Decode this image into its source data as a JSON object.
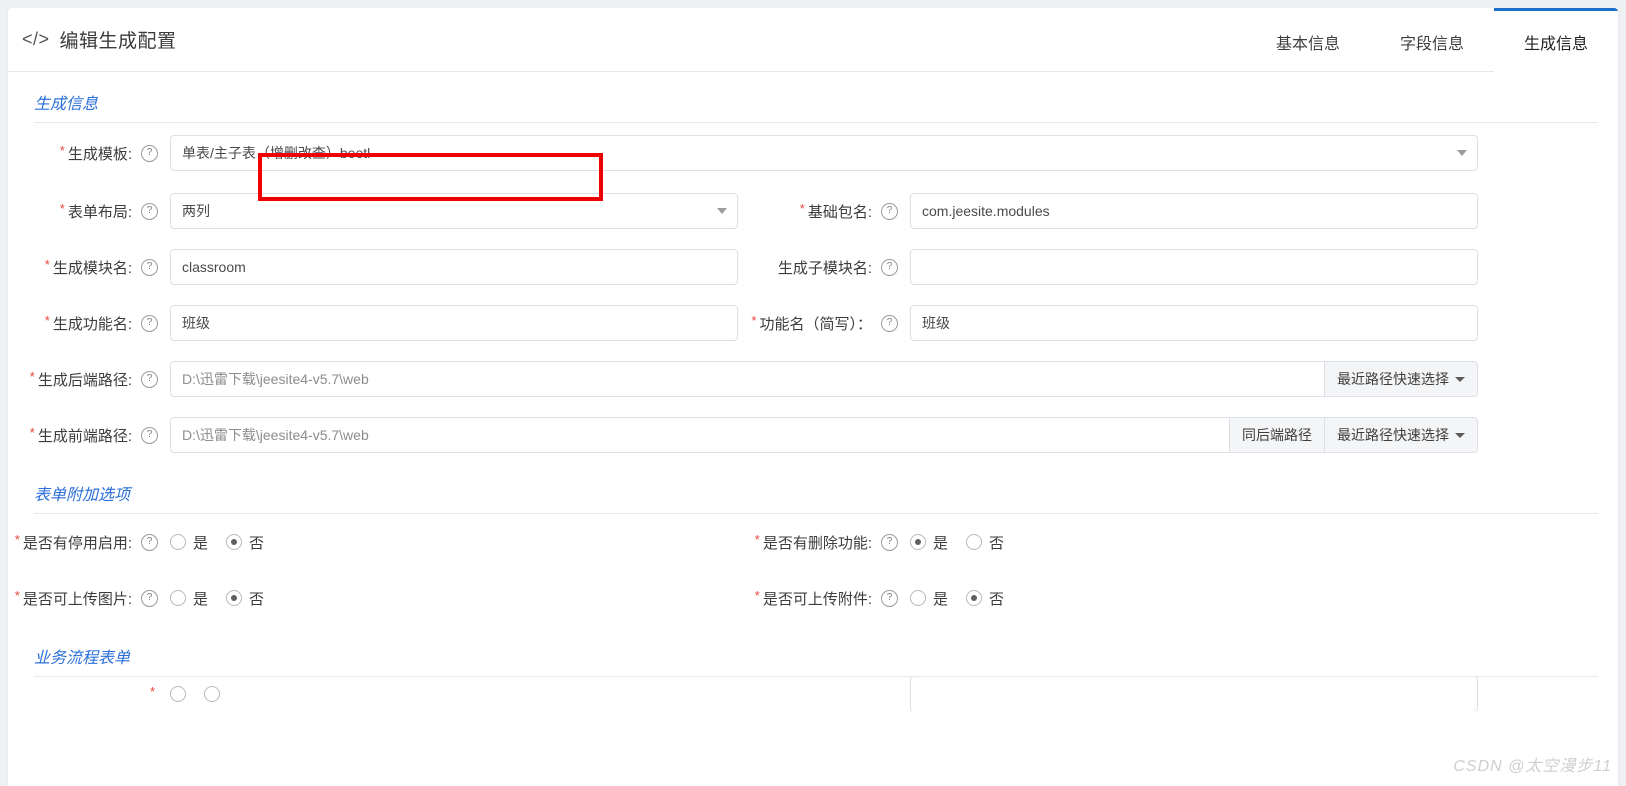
{
  "header": {
    "title": "编辑生成配置",
    "code_icon": "</>",
    "tabs": [
      {
        "label": "基本信息",
        "active": false
      },
      {
        "label": "字段信息",
        "active": false
      },
      {
        "label": "生成信息",
        "active": true
      }
    ]
  },
  "sections": {
    "generate_info": "生成信息",
    "form_extra": "表单附加选项",
    "workflow_form": "业务流程表单"
  },
  "fields": {
    "template": {
      "label": "生成模板:",
      "required": true,
      "help": "?",
      "value": "单表/主子表（增删改查）beetl",
      "caret": "chevron-down-icon"
    },
    "form_layout": {
      "label": "表单布局:",
      "required": true,
      "help": "?",
      "value": "两列",
      "caret": "chevron-down-icon"
    },
    "base_package": {
      "label": "基础包名:",
      "required": true,
      "help": "?",
      "value": "com.jeesite.modules"
    },
    "module_name": {
      "label": "生成模块名:",
      "required": true,
      "help": "?",
      "value": "classroom"
    },
    "sub_module_name": {
      "label": "生成子模块名:",
      "required": false,
      "help": "?",
      "value": ""
    },
    "function_name": {
      "label": "生成功能名:",
      "required": true,
      "help": "?",
      "value": "班级"
    },
    "function_name_simple": {
      "label": "功能名（简写）：",
      "required": true,
      "help": "?",
      "value": "班级"
    },
    "backend_path": {
      "label": "生成后端路径:",
      "required": true,
      "help": "?",
      "value": "D:\\迅雷下载\\jeesite4-v5.7\\web",
      "buttons": [
        {
          "label": "最近路径快速选择",
          "caret": true
        }
      ]
    },
    "frontend_path": {
      "label": "生成前端路径:",
      "required": true,
      "help": "?",
      "value": "D:\\迅雷下载\\jeesite4-v5.7\\web",
      "buttons": [
        {
          "label": "同后端路径",
          "caret": false
        },
        {
          "label": "最近路径快速选择",
          "caret": true
        }
      ]
    }
  },
  "radio_options": {
    "yes": "是",
    "no": "否"
  },
  "radio_fields": [
    {
      "key": "has_disable_enable",
      "label": "是否有停用启用:",
      "required": true,
      "help": "?",
      "selected": "否",
      "column": "left"
    },
    {
      "key": "has_delete",
      "label": "是否有删除功能:",
      "required": true,
      "help": "?",
      "selected": "是",
      "column": "right"
    },
    {
      "key": "can_upload_image",
      "label": "是否可上传图片:",
      "required": true,
      "help": "?",
      "selected": "否",
      "column": "left"
    },
    {
      "key": "can_upload_attachment",
      "label": "是否可上传附件:",
      "required": true,
      "help": "?",
      "selected": "否",
      "column": "right"
    }
  ],
  "annotation": {
    "color": "#f00000",
    "target": "生成模板 输入框"
  },
  "watermark": "CSDN @太空漫步11"
}
